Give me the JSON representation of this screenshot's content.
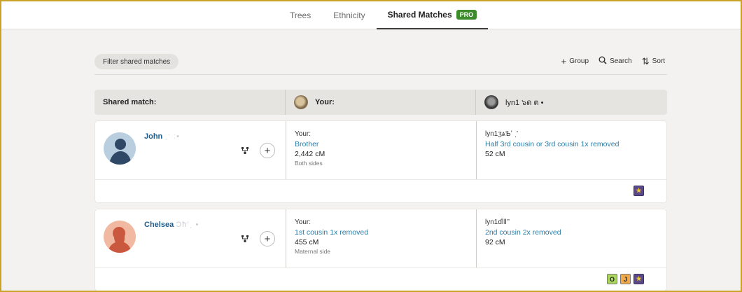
{
  "tabs": [
    {
      "label": "Trees"
    },
    {
      "label": "Ethnicity"
    },
    {
      "label": "Shared Matches",
      "badge": "PRO"
    }
  ],
  "toolbar": {
    "filter_label": "Filter shared matches",
    "group_label": "Group",
    "search_label": "Search",
    "sort_label": "Sort"
  },
  "header": {
    "shared_match": "Shared match:",
    "your": "Your:",
    "other": "lyn1 ๖ด ต •"
  },
  "matches": [
    {
      "name": "John",
      "name_obscured": "ˌˑ ː•",
      "your_label": "Your:",
      "your_relationship": "Brother",
      "your_cm": "2,442 cM",
      "your_side": "Both sides",
      "other_label": "lyn1ӡѧѢʼ ˌ’",
      "other_relationship": "Half 3rd cousin or 3rd cousin 1x removed",
      "other_cm": "52 cM",
      "badges": [
        "★"
      ]
    },
    {
      "name": "Chelsea",
      "name_obscured": "Ɔħ’ˌ •",
      "your_label": "Your:",
      "your_relationship": "1st cousin 1x removed",
      "your_cm": "455 cM",
      "your_side": "Maternal side",
      "other_label": "lyn1ɗİǁ’’",
      "other_relationship": "2nd cousin 2x removed",
      "other_cm": "92 cM",
      "badges": [
        "O",
        "J",
        "★"
      ]
    }
  ],
  "colors": {
    "link": "#2a7ea8",
    "name": "#1f5e8f",
    "pro_badge": "#3d8c2c",
    "frame_border": "#c9a227"
  },
  "icons": {
    "tree": "tree-icon",
    "plus": "plus-icon",
    "search": "search-icon",
    "sort": "sort-icon",
    "group": "plus-icon",
    "star": "star-icon"
  }
}
